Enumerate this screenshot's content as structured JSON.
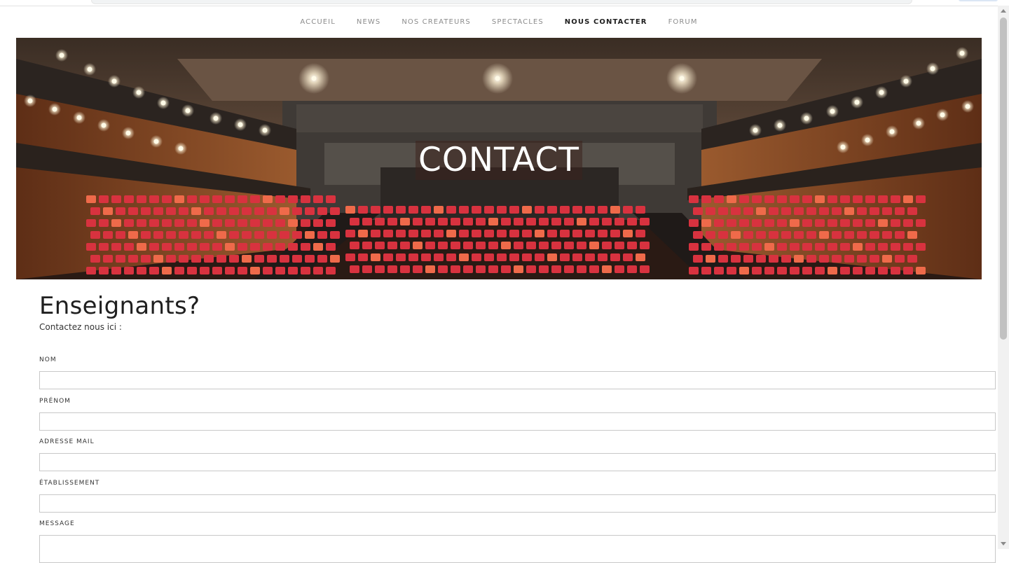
{
  "nav": {
    "items": [
      {
        "label": "ACCUEIL",
        "active": false
      },
      {
        "label": "NEWS",
        "active": false
      },
      {
        "label": "NOS CREATEURS",
        "active": false
      },
      {
        "label": "SPECTACLES",
        "active": false
      },
      {
        "label": "NOUS CONTACTER",
        "active": true
      },
      {
        "label": "FORUM",
        "active": false
      }
    ]
  },
  "hero": {
    "title": "CONTACT",
    "image": "theater-auditorium-photo"
  },
  "main": {
    "heading": "Enseignants?",
    "subtitle": "Contactez nous ici :"
  },
  "form": {
    "fields": [
      {
        "label": "NOM",
        "value": ""
      },
      {
        "label": "PRÉNOM",
        "value": ""
      },
      {
        "label": "ADRESSE MAIL",
        "value": ""
      },
      {
        "label": "ÉTABLISSEMENT",
        "value": ""
      },
      {
        "label": "MESSAGE",
        "value": ""
      }
    ]
  },
  "colors": {
    "seat_red": "#d8323f",
    "seat_orange": "#ef6a4a",
    "wood": "#8a4a25",
    "nav_active": "#1f1f1f",
    "nav_inactive": "#8c8c8c"
  }
}
